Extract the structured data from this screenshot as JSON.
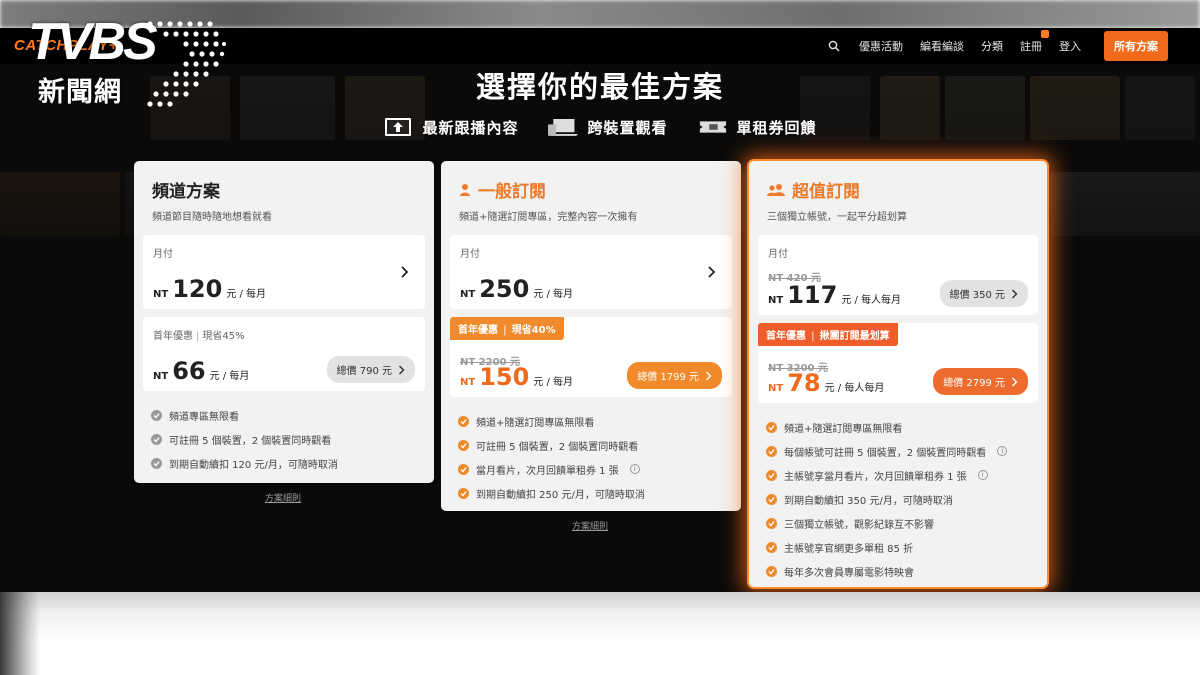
{
  "watermark": {
    "mark": "TVBS",
    "subtitle": "新聞網"
  },
  "nav": {
    "brand": "CATCHPLAY+",
    "links": [
      "優惠活動",
      "編看編談",
      "分類",
      "註冊",
      "登入"
    ],
    "cta": "所有方案"
  },
  "hero": {
    "headline": "選擇你的最佳方案",
    "features": [
      {
        "icon": "upload-screen-icon",
        "label": "最新跟播內容"
      },
      {
        "icon": "devices-icon",
        "label": "跨裝置觀看"
      },
      {
        "icon": "ticket-icon",
        "label": "單租券回饋"
      }
    ]
  },
  "plans": [
    {
      "title": "頻道方案",
      "subtitle": "頻道節目隨時隨地想看就看",
      "monthly": {
        "label": "月付",
        "nt": "NT",
        "price": "120",
        "unit": "元 / 每月"
      },
      "promo": {
        "label": "首年優惠",
        "discount": "現省45%",
        "nt": "NT",
        "price": "66",
        "unit": "元 / 每月",
        "total": "總價 790 元"
      },
      "benefits": [
        "頻道專區無限看",
        "可註冊 5 個裝置，2 個裝置同時觀看",
        "到期自動續扣 120 元/月，可隨時取消"
      ],
      "terms": "方案細則"
    },
    {
      "title": "一般訂閱",
      "subtitle": "頻道+隨選訂閱專區，完整內容一次擁有",
      "monthly": {
        "label": "月付",
        "nt": "NT",
        "price": "250",
        "unit": "元 / 每月"
      },
      "promo": {
        "label": "首年優惠",
        "discount": "現省40%",
        "original": "NT 2200 元",
        "nt": "NT",
        "price": "150",
        "unit": "元 / 每月",
        "total": "總價 1799 元"
      },
      "benefits": [
        "頻道+隨選訂閱專區無限看",
        "可註冊 5 個裝置，2 個裝置同時觀看",
        "當月看片，次月回饋單租券 1 張",
        "到期自動續扣 250 元/月，可隨時取消"
      ],
      "terms": "方案細則"
    },
    {
      "title": "超值訂閱",
      "subtitle": "三個獨立帳號，一起平分超划算",
      "monthly": {
        "label": "月付",
        "original": "NT 420 元",
        "nt": "NT",
        "price": "117",
        "unit": "元 / 每人每月",
        "total": "總價 350 元"
      },
      "promo": {
        "label": "首年優惠",
        "discount": "揪團訂閱最划算",
        "original": "NT 3200 元",
        "nt": "NT",
        "price": "78",
        "unit": "元 / 每人每月",
        "total": "總價 2799 元"
      },
      "benefits": [
        "頻道+隨選訂閱專區無限看",
        "每個帳號可註冊 5 個裝置，2 個裝置同時觀看",
        "主帳號享當月看片，次月回饋單租券 1 張",
        "到期自動續扣 350 元/月，可隨時取消",
        "三個獨立帳號，觀影紀錄互不影響",
        "主帳號享官網更多單租 85 折",
        "每年多次會員專屬電影特映會"
      ]
    }
  ],
  "colors": {
    "accent": "#f26b1d",
    "accent_light": "#f08a2a",
    "card_bg": "#f2f2f2",
    "page_bg": "#0a0a0a"
  }
}
